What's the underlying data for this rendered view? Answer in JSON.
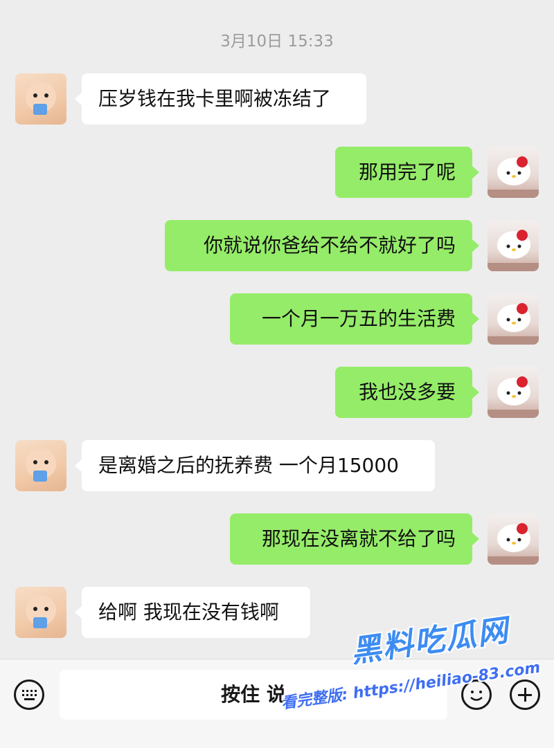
{
  "chat": {
    "timestamp": "3月10日 15:33",
    "messages": [
      {
        "side": "in",
        "text": "压岁钱在我卡里啊被冻结了"
      },
      {
        "side": "out",
        "text": "那用完了呢"
      },
      {
        "side": "out",
        "text": "你就说你爸给不给不就好了吗"
      },
      {
        "side": "out",
        "text": "一个月一万五的生活费"
      },
      {
        "side": "out",
        "text": "我也没多要"
      },
      {
        "side": "in",
        "text": "是离婚之后的抚养费 一个月15000"
      },
      {
        "side": "out",
        "text": "那现在没离就不给了吗"
      },
      {
        "side": "in",
        "text": "给啊 我现在没有钱啊"
      }
    ]
  },
  "input_bar": {
    "hold_to_talk_label": "按住 说",
    "keyboard_icon": "keyboard-icon",
    "emoji_icon": "emoji-icon",
    "plus_icon": "plus-icon"
  },
  "watermark": {
    "title": "黑料吃瓜网",
    "url_text": "看完整版: https://heiliao-83.com"
  },
  "colors": {
    "background": "#ededed",
    "outgoing_bubble": "#95ec69",
    "incoming_bubble": "#ffffff",
    "watermark": "#3d8cf2"
  }
}
